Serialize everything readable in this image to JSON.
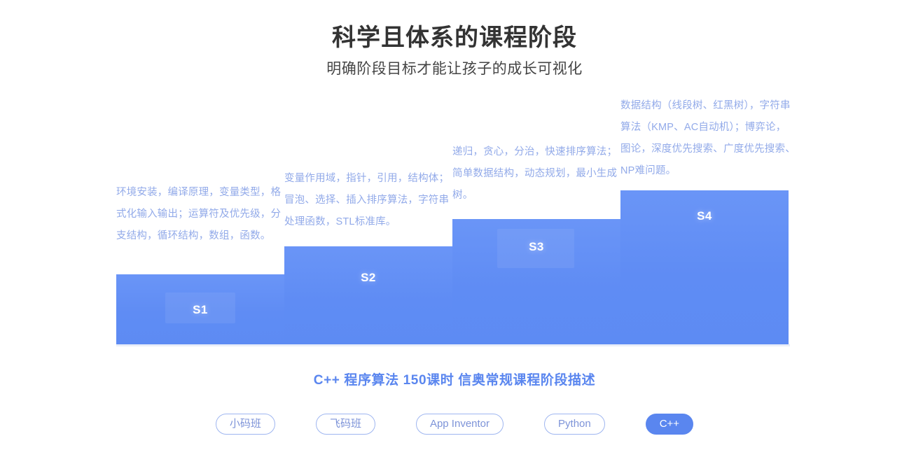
{
  "header": {
    "title": "科学且体系的课程阶段",
    "subtitle": "明确阶段目标才能让孩子的成长可视化"
  },
  "caption": "C++ 程序算法 150课时 信奥常规课程阶段描述",
  "colors": {
    "bar_blue": "#5f8cf4",
    "bar_blue_light": "#6a95f7",
    "desc_text": "#92aae9",
    "caption_blue": "#5a86ef",
    "tab_border": "#9fb6f0",
    "tab_text": "#7d93d8",
    "tab_active_bg": "#5a86ef",
    "baseline": "#e9eef9",
    "title_text": "#333333"
  },
  "chart_data": {
    "type": "bar",
    "title": "科学且体系的课程阶段",
    "subtitle": "明确阶段目标才能让孩子的成长可视化",
    "xlabel": "",
    "ylabel": "",
    "grid": false,
    "legend": "none",
    "categories": [
      "S1",
      "S2",
      "S3",
      "S4"
    ],
    "values": [
      100,
      140,
      179,
      220
    ],
    "annotations": [
      "环境安装，编译原理，变量类型，格式化输入输出；运算符及优先级，分支结构，循环结构，数组，函数。",
      "变量作用域，指针，引用，结构体；冒泡、选择、插入排序算法，字符串处理函数，STL标准库。",
      "递归，贪心，分治，快速排序算法；简单数据结构，动态规划，最小生成树。",
      "数据结构（线段树、红黑树），字符串算法（KMP、AC自动机）；博弈论，图论，深度优先搜索、广度优先搜索、NP难问题。"
    ]
  },
  "stages": [
    {
      "label": "S1",
      "description": "环境安装，编译原理，变量类型，格式化输入输出；运算符及优先级，分支结构，循环结构，数组，函数。"
    },
    {
      "label": "S2",
      "description": "变量作用域，指针，引用，结构体；冒泡、选择、插入排序算法，字符串处理函数，STL标准库。"
    },
    {
      "label": "S3",
      "description": "递归，贪心，分治，快速排序算法；简单数据结构，动态规划，最小生成树。"
    },
    {
      "label": "S4",
      "description": "数据结构（线段树、红黑树），字符串算法（KMP、AC自动机）；博弈论，图论，深度优先搜索、广度优先搜索、NP难问题。"
    }
  ],
  "tabs": [
    {
      "label": "小码班",
      "active": false
    },
    {
      "label": "飞码班",
      "active": false
    },
    {
      "label": "App Inventor",
      "active": false
    },
    {
      "label": "Python",
      "active": false
    },
    {
      "label": "C++",
      "active": true
    }
  ]
}
